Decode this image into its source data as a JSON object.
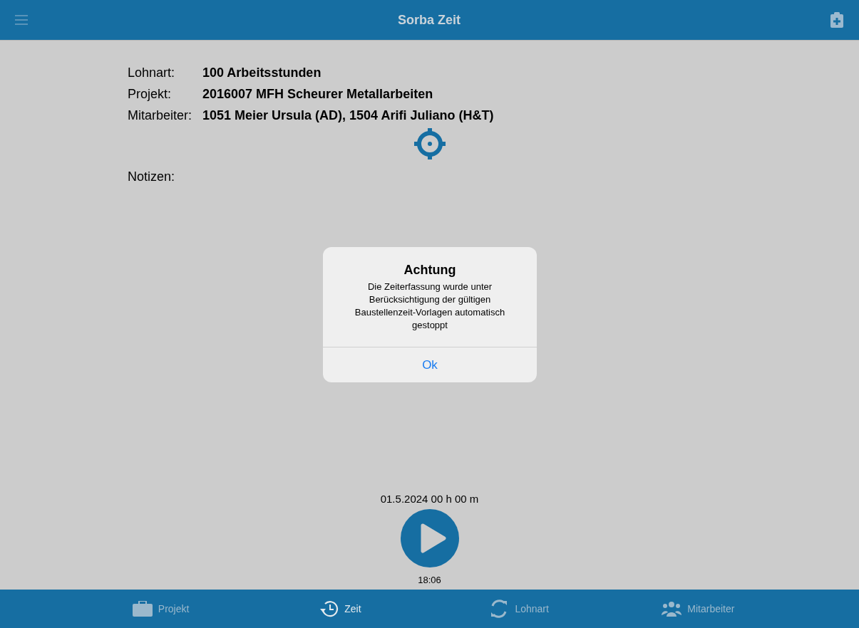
{
  "header": {
    "title": "Sorba Zeit"
  },
  "details": [
    {
      "label": "Lohnart:",
      "value": "100 Arbeitsstunden"
    },
    {
      "label": "Projekt:",
      "value": "2016007 MFH Scheurer Metallarbeiten"
    },
    {
      "label": "Mitarbeiter:",
      "value": "1051 Meier Ursula (AD), 1504 Arifi Juliano (H&T)"
    }
  ],
  "notes_label": "Notizen:",
  "alert": {
    "title": "Achtung",
    "message": "Die Zeiterfassung wurde unter Berücksichtigung der gültigen Baustellenzeit-Vorlagen automatisch gestoppt",
    "button": "Ok"
  },
  "timer": {
    "date_duration": "01.5.2024 00 h 00 m",
    "time": "18:06"
  },
  "tabs": [
    {
      "kind": "briefcase",
      "label": "Projekt",
      "selected": false
    },
    {
      "kind": "clock",
      "label": "Zeit",
      "selected": true
    },
    {
      "kind": "cycle",
      "label": "Lohnart",
      "selected": false
    },
    {
      "kind": "people",
      "label": "Mitarbeiter",
      "selected": false
    }
  ]
}
